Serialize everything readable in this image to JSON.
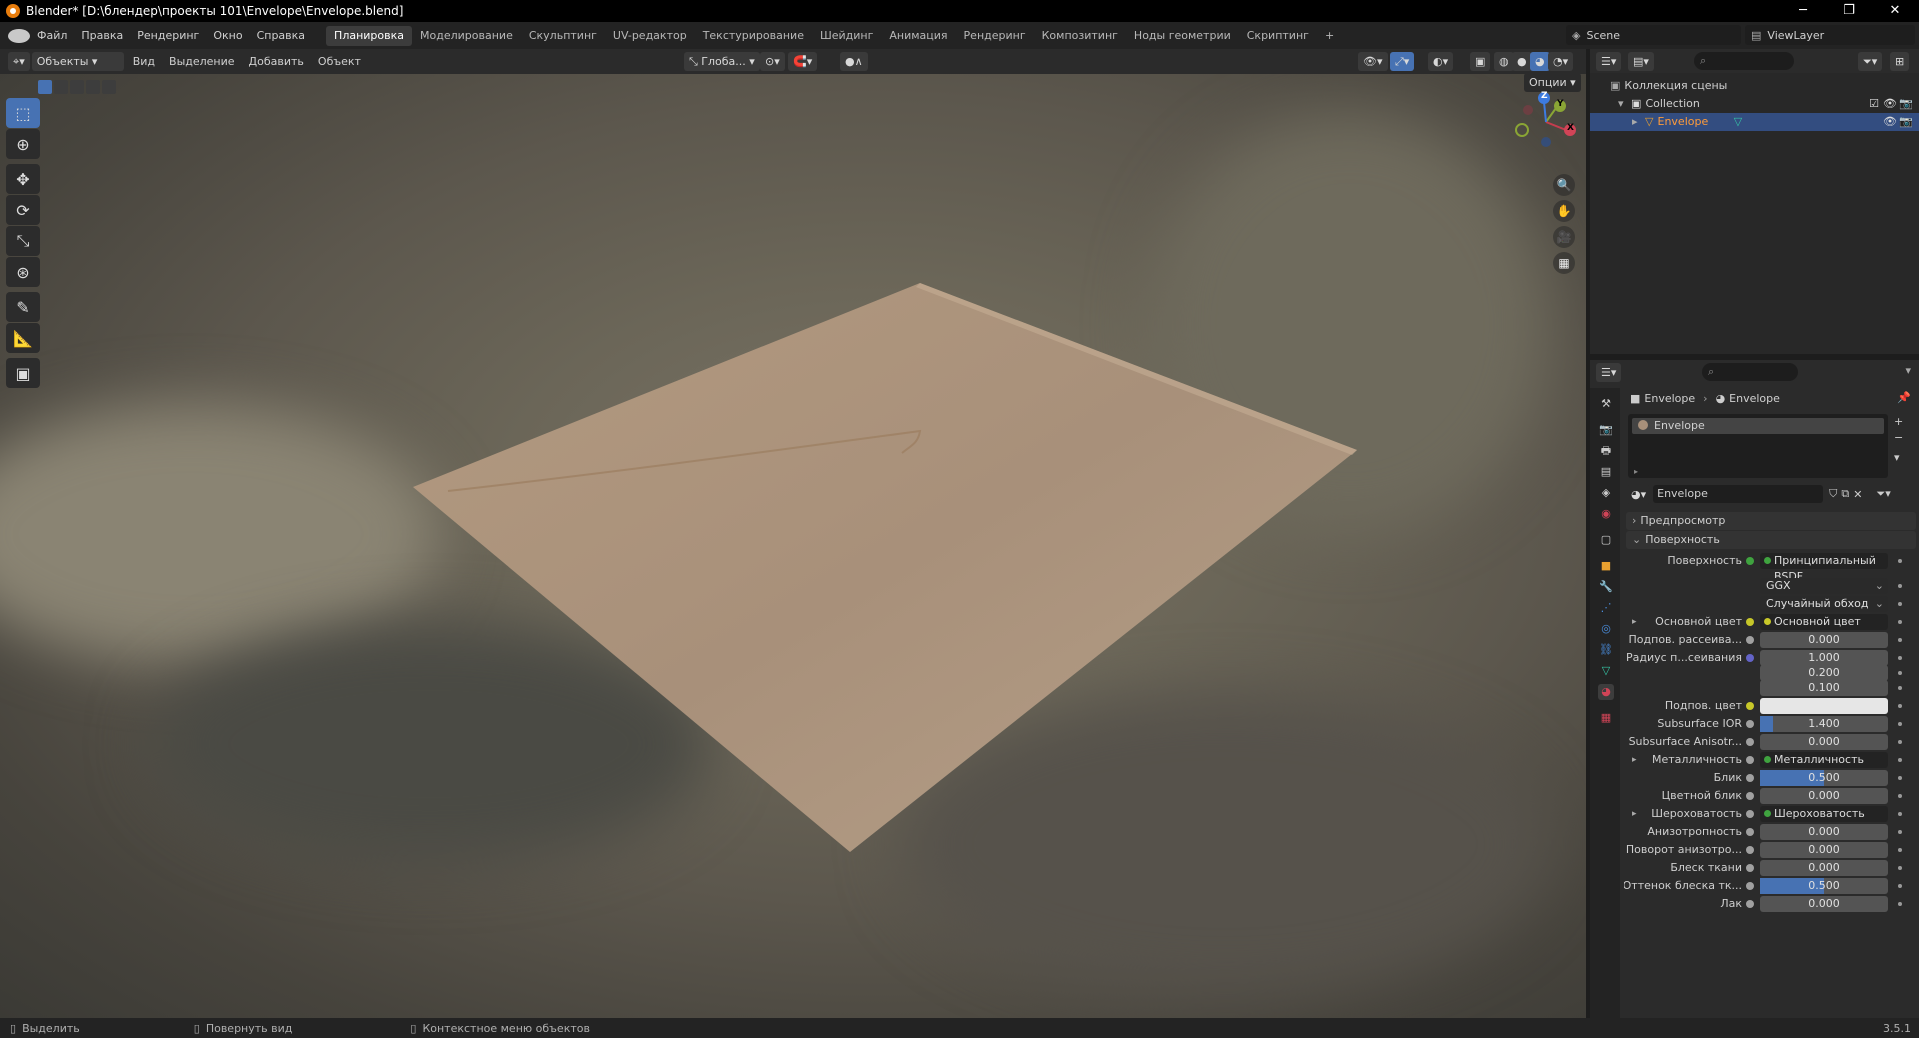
{
  "window": {
    "title": "Blender* [D:\\блендер\\проекты 101\\Envelope\\Envelope.blend]",
    "minimize": "─",
    "maximize": "❐",
    "close": "✕"
  },
  "menu": {
    "items": [
      "Файл",
      "Правка",
      "Рендеринг",
      "Окно",
      "Справка"
    ]
  },
  "workspaces": {
    "tabs": [
      "Планировка",
      "Моделирование",
      "Скульптинг",
      "UV-редактор",
      "Текстурирование",
      "Шейдинг",
      "Анимация",
      "Рендеринг",
      "Композитинг",
      "Ноды геометрии",
      "Скриптинг"
    ],
    "active": 0,
    "add": "+"
  },
  "scene": {
    "name": "Scene",
    "view_layer": "ViewLayer"
  },
  "viewport_header": {
    "mode": "Объекты",
    "view": "Вид",
    "select": "Выделение",
    "add": "Добавить",
    "object": "Объект",
    "transform": "Глоба...",
    "options": "Опции"
  },
  "outliner": {
    "root": "Коллекция сцены",
    "collection": "Collection",
    "object": "Envelope"
  },
  "properties": {
    "breadcrumb": [
      "Envelope",
      "Envelope"
    ],
    "material_slot": "Envelope",
    "material_name": "Envelope",
    "panels": {
      "preview": "Предпросмотр",
      "surface": "Поверхность"
    },
    "rows": [
      {
        "label": "Поверхность",
        "value": "Принципиальный BSDF",
        "kind": "link",
        "dot": "#3fa33f"
      },
      {
        "label": "",
        "value": "GGX",
        "kind": "select"
      },
      {
        "label": "",
        "value": "Случайный обход",
        "kind": "select"
      },
      {
        "label": "Основной цвет",
        "value": "Основной цвет",
        "kind": "link",
        "dot": "#c7c729",
        "expand": "▸"
      },
      {
        "label": "Подпов. рассеива...",
        "value": "0.000",
        "kind": "num",
        "dot": "#a0a0a0",
        "fill": 0
      },
      {
        "label": "Радиус п...сеивания",
        "value": "1.000",
        "kind": "num",
        "dot": "#6363c7",
        "fill": 0
      },
      {
        "label": "",
        "value": "0.200",
        "kind": "num",
        "fill": 0
      },
      {
        "label": "",
        "value": "0.100",
        "kind": "num",
        "fill": 0
      },
      {
        "label": "Подпов. цвет",
        "value": "",
        "kind": "color",
        "dot": "#c7c729"
      },
      {
        "label": "Subsurface IOR",
        "value": "1.400",
        "kind": "num",
        "dot": "#a0a0a0",
        "fill": 0.1
      },
      {
        "label": "Subsurface Anisotr...",
        "value": "0.000",
        "kind": "num",
        "dot": "#a0a0a0",
        "fill": 0
      },
      {
        "label": "Металличность",
        "value": "Металличность",
        "kind": "link",
        "dot": "#a0a0a0",
        "expand": "▸"
      },
      {
        "label": "Блик",
        "value": "0.500",
        "kind": "num",
        "dot": "#a0a0a0",
        "fill": 0.5
      },
      {
        "label": "Цветной блик",
        "value": "0.000",
        "kind": "num",
        "dot": "#a0a0a0",
        "fill": 0
      },
      {
        "label": "Шероховатость",
        "value": "Шероховатость",
        "kind": "link",
        "dot": "#a0a0a0",
        "expand": "▸"
      },
      {
        "label": "Анизотропность",
        "value": "0.000",
        "kind": "num",
        "dot": "#a0a0a0",
        "fill": 0
      },
      {
        "label": "Поворот анизотро...",
        "value": "0.000",
        "kind": "num",
        "dot": "#a0a0a0",
        "fill": 0
      },
      {
        "label": "Блеск ткани",
        "value": "0.000",
        "kind": "num",
        "dot": "#a0a0a0",
        "fill": 0
      },
      {
        "label": "Оттенок блеска тк...",
        "value": "0.500",
        "kind": "num",
        "dot": "#a0a0a0",
        "fill": 0.5
      },
      {
        "label": "Лак",
        "value": "0.000",
        "kind": "num",
        "dot": "#a0a0a0",
        "fill": 0
      }
    ]
  },
  "status": {
    "select": "Выделить",
    "rotate": "Повернуть вид",
    "context": "Контекстное меню объектов",
    "version": "3.5.1"
  },
  "gizmo": {
    "x": "X",
    "y": "Y",
    "z": "Z"
  }
}
